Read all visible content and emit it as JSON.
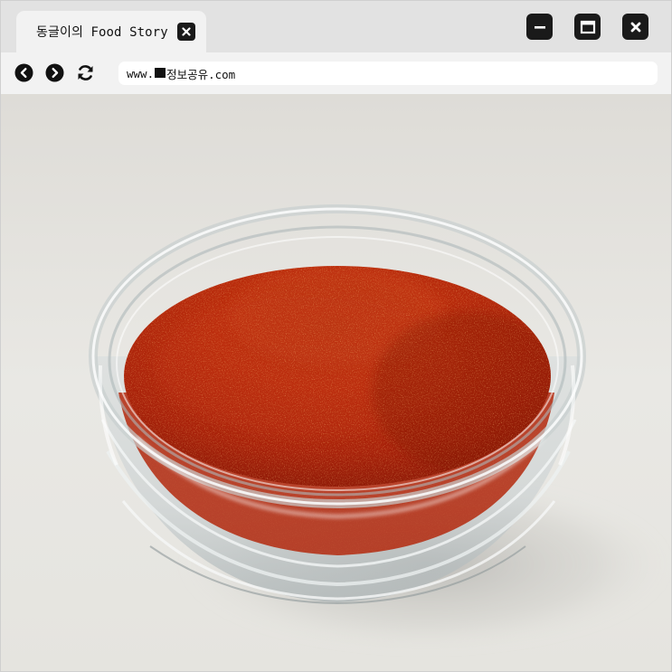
{
  "tab": {
    "title": "동글이의 Food Story",
    "close_icon": "close-icon"
  },
  "window_controls": {
    "minimize_icon": "minimize-icon",
    "maximize_icon": "maximize-icon",
    "close_icon": "close-icon"
  },
  "toolbar": {
    "back_icon": "arrow-left-icon",
    "forward_icon": "arrow-right-icon",
    "reload_icon": "reload-icon",
    "url_prefix": "www.",
    "url_suffix": "정보공유.com"
  },
  "content": {
    "image_subject": "glass bowl of red chili pepper powder",
    "colors": {
      "background": "#e7e6e2",
      "powder": "#b8280e",
      "glass": "#cfd6d8"
    }
  },
  "colors": {
    "titlebar": "#e2e2e2",
    "toolbar": "#f2f2f2",
    "buttons": "#1a1a1a"
  }
}
